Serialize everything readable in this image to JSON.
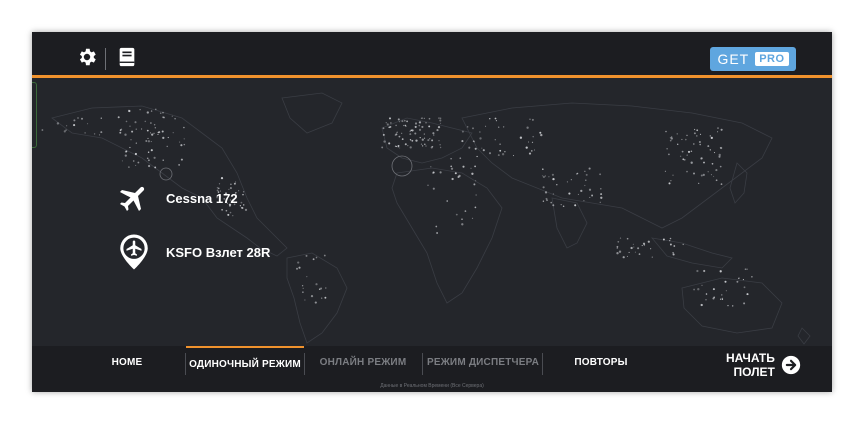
{
  "header": {
    "settings_icon": "gear-icon",
    "logbook_icon": "book-icon",
    "get_label": "GET",
    "pro_label": "PRO"
  },
  "flight_info": {
    "aircraft": {
      "icon": "airplane-icon",
      "label": "Cessna 172"
    },
    "location": {
      "icon": "location-pin-airplane-icon",
      "label": "KSFO Взлет 28R"
    }
  },
  "bottom_nav": {
    "items": [
      {
        "label": "HOME",
        "state": "normal"
      },
      {
        "label": "ОДИНОЧНЫЙ РЕЖИМ",
        "state": "active"
      },
      {
        "label": "ОНЛАЙН РЕЖИМ",
        "state": "disabled"
      },
      {
        "label": "РЕЖИМ ДИСПЕТЧЕРА",
        "state": "disabled"
      },
      {
        "label": "ПОВТОРЫ",
        "state": "normal"
      }
    ],
    "start_line1": "НАЧАТЬ",
    "start_line2": "ПОЛЕТ",
    "start_icon": "arrow-right-circle-icon",
    "footer_note": "Данные в Реальном Времени (Все Сервера)"
  },
  "colors": {
    "accent": "#f0922d",
    "pro_button": "#5fa6df",
    "background": "#24262b",
    "bar": "#1c1d21"
  }
}
